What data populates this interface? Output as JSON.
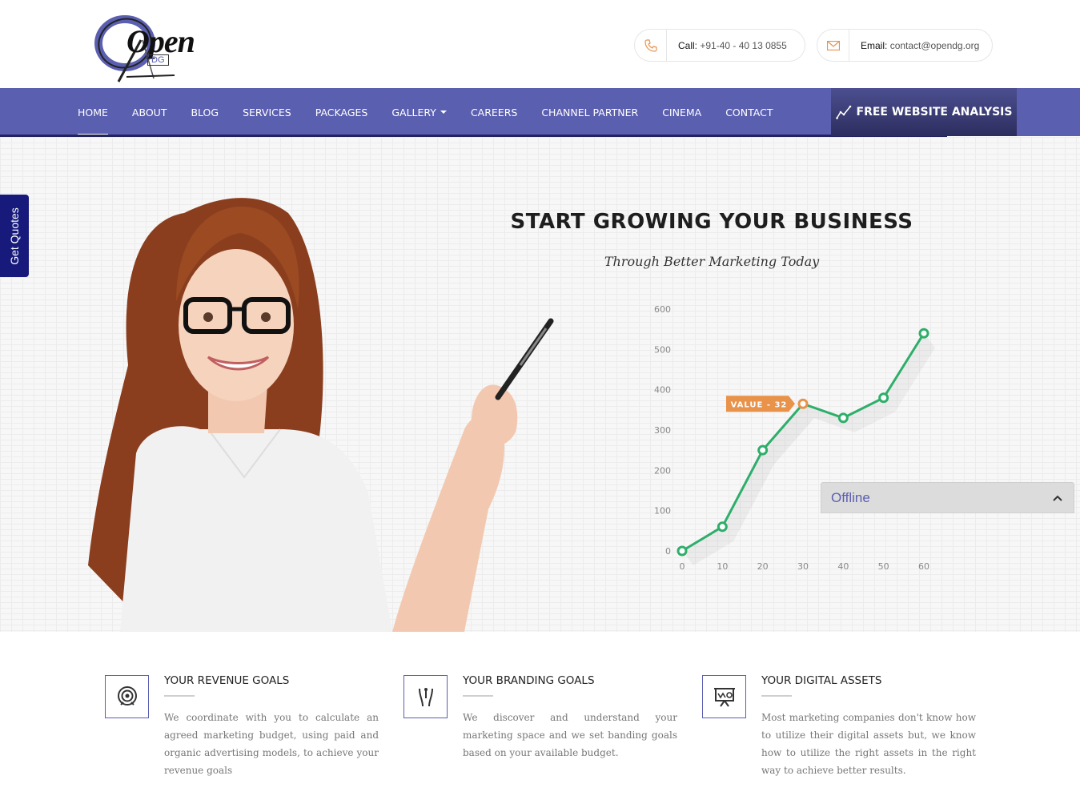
{
  "brand": {
    "logo_word": "Open",
    "logo_sub": "DG"
  },
  "contact": {
    "call_label": "Call",
    "call_value": "+91-40 - 40 13 0855",
    "email_label": "Email",
    "email_value": "contact@opendg.org"
  },
  "nav": {
    "items": [
      {
        "label": "HOME"
      },
      {
        "label": "ABOUT"
      },
      {
        "label": "BLOG"
      },
      {
        "label": "SERVICES"
      },
      {
        "label": "PACKAGES"
      },
      {
        "label": "GALLERY"
      },
      {
        "label": "CAREERS"
      },
      {
        "label": "CHANNEL PARTNER"
      },
      {
        "label": "CINEMA"
      },
      {
        "label": "CONTACT"
      }
    ],
    "cta_label": "FREE WEBSITE ANALYSIS"
  },
  "side_tab": {
    "label": "Get Quotes"
  },
  "hero": {
    "title": "START GROWING YOUR BUSINESS",
    "subtitle": "Through Better Marketing Today"
  },
  "chart_data": {
    "type": "line",
    "x": [
      0,
      10,
      20,
      30,
      40,
      50,
      60
    ],
    "y": [
      0,
      60,
      250,
      365,
      330,
      380,
      540
    ],
    "xticks": [
      "0",
      "10",
      "20",
      "30",
      "40",
      "50",
      "60"
    ],
    "yticks": [
      "0",
      "100",
      "200",
      "300",
      "400",
      "500",
      "600"
    ],
    "xlim": [
      0,
      60
    ],
    "ylim": [
      0,
      600
    ],
    "highlight_index": 3,
    "highlight_label": "VALUE - 32",
    "line_color": "#2eae6a",
    "highlight_color": "#e8924a",
    "grid": false
  },
  "chat": {
    "status": "Offline"
  },
  "features": [
    {
      "heading": "YOUR REVENUE GOALS",
      "text": "We coordinate with you to calculate an agreed marketing budget, using paid and organic advertising models, to achieve your revenue goals",
      "icon": "target-icon"
    },
    {
      "heading": "YOUR BRANDING GOALS",
      "text": "We discover and understand your marketing space and we set banding goals based on your available budget.",
      "icon": "branding-icon"
    },
    {
      "heading": "YOUR DIGITAL ASSETS",
      "text": "Most marketing companies don't know how to utilize their digital assets but, we know how to utilize the right assets in the right way to achieve better results.",
      "icon": "presentation-board-icon"
    }
  ],
  "colors": {
    "primary": "#5b5fb0",
    "nav_dark": "#23245e",
    "side_tab": "#171a7a",
    "accent": "#e8924a"
  }
}
